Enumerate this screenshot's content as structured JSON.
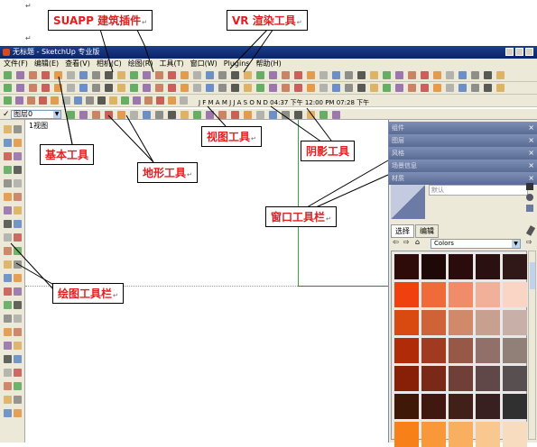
{
  "window": {
    "title": "无标题 - SketchUp 专业版"
  },
  "menu": {
    "items": [
      "文件(F)",
      "编辑(E)",
      "查看(V)",
      "相机(C)",
      "绘图(R)",
      "工具(T)",
      "窗口(W)",
      "Plugins",
      "帮助(H)"
    ]
  },
  "layer": {
    "check": "✓",
    "value": "图层0"
  },
  "scene_tab": "1视图",
  "shadow": {
    "months": "J F M A M J J A S O N D",
    "time1": "04:37 下午",
    "time2": "12:00 PM",
    "time3": "07:28 下午"
  },
  "tray_panels": [
    "组件",
    "图层",
    "风格",
    "场景信息",
    "材质"
  ],
  "materials": {
    "name_placeholder": "默认",
    "tab_select": "选择",
    "tab_edit": "编辑",
    "collection": "Colors",
    "swatches": [
      "#2e0a08",
      "#1f0808",
      "#2a0c0c",
      "#2a1010",
      "#301818",
      "#f04010",
      "#f06a3a",
      "#f08c6a",
      "#f0b09a",
      "#fad4c4",
      "#d84a10",
      "#d06238",
      "#d08a6a",
      "#c8a090",
      "#c8b0a8",
      "#b02c08",
      "#a03a20",
      "#985848",
      "#907068",
      "#908078",
      "#882008",
      "#7a2818",
      "#704038",
      "#604848",
      "#585050",
      "#401808",
      "#401810",
      "#402018",
      "#382020",
      "#303030",
      "#f88018",
      "#f89838",
      "#f8b060",
      "#f8c890",
      "#f8dcc0"
    ]
  },
  "annotations": {
    "suapp": "SUAPP 建筑插件",
    "vr": "VR 渲染工具",
    "basic": "基本工具",
    "view": "视图工具",
    "shadow": "阴影工具",
    "terrain": "地形工具",
    "window": "窗口工具栏",
    "draw": "绘图工具栏"
  },
  "para_mark": "↵",
  "colors": {
    "callout_text": "#e02020",
    "titlebar": "#0a246a",
    "tray_header": "#6a7aa4"
  }
}
